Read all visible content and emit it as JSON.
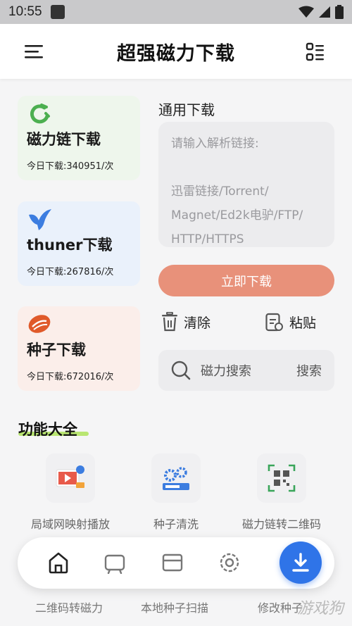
{
  "status": {
    "time": "10:55"
  },
  "app": {
    "title": "超强磁力下载"
  },
  "cards": [
    {
      "title": "磁力链下载",
      "stats": "今日下载:340951/次",
      "bg": "#eef6ec",
      "icon": "magnet-icon"
    },
    {
      "title": "thuner下载",
      "stats": "今日下载:267816/次",
      "bg": "#eaf1fb",
      "icon": "bird-icon"
    },
    {
      "title": "种子下载",
      "stats": "今日下载:672016/次",
      "bg": "#fbeeea",
      "icon": "seed-icon"
    }
  ],
  "download": {
    "section_title": "通用下载",
    "placeholder": "请输入解析链接:\n\n迅雷链接/Torrent/\nMagnet/Ed2k电驴/FTP/\nHTTP/HTTPS",
    "button_label": "立即下载",
    "clear_label": "清除",
    "paste_label": "粘贴"
  },
  "search": {
    "placeholder": "磁力搜索",
    "button_label": "搜索"
  },
  "features": {
    "title": "功能大全",
    "items": [
      {
        "label": "局域网映射播放",
        "icon": "cast-play-icon"
      },
      {
        "label": "种子清洗",
        "icon": "gears-icon"
      },
      {
        "label": "磁力链转二维码",
        "icon": "qrcode-icon"
      }
    ],
    "peek_labels": [
      "二维码转磁力",
      "本地种子扫描",
      "修改种子"
    ]
  },
  "nav": {
    "items": [
      "home-icon",
      "tv-icon",
      "card-icon",
      "settings-icon"
    ],
    "fab": "download-icon"
  },
  "colors": {
    "accent": "#2f74e8",
    "download_button": "#e8917a",
    "highlight": "#9fe03a"
  },
  "watermark": "游戏狗"
}
